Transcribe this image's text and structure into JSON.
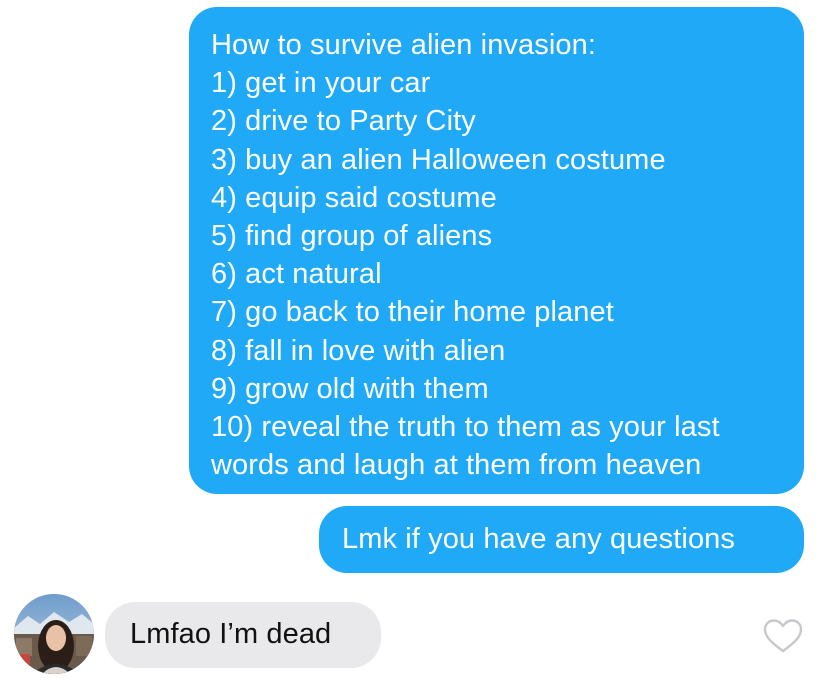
{
  "messages": [
    {
      "direction": "sent",
      "lines": [
        "How to survive alien invasion:",
        "1) get in your car",
        "2) drive to Party City",
        "3) buy an alien Halloween costume",
        "4) equip said costume",
        "5) find group of aliens",
        "6) act natural",
        "7) go back to their home planet",
        "8) fall in love with alien",
        "9) grow old with them",
        "10) reveal the truth to them as your last",
        "words and laugh at them from heaven"
      ]
    },
    {
      "direction": "sent",
      "text": "Lmk if you have any questions"
    },
    {
      "direction": "received",
      "text": "Lmfao I’m dead",
      "avatar": "profile-photo",
      "reaction_icon": "heart-outline-icon"
    }
  ],
  "colors": {
    "sent_bubble": "#1fa9f7",
    "received_bubble": "#e9e9eb",
    "sent_text": "#ffffff",
    "received_text": "#111111",
    "heart_outline": "#c7c7cc"
  }
}
